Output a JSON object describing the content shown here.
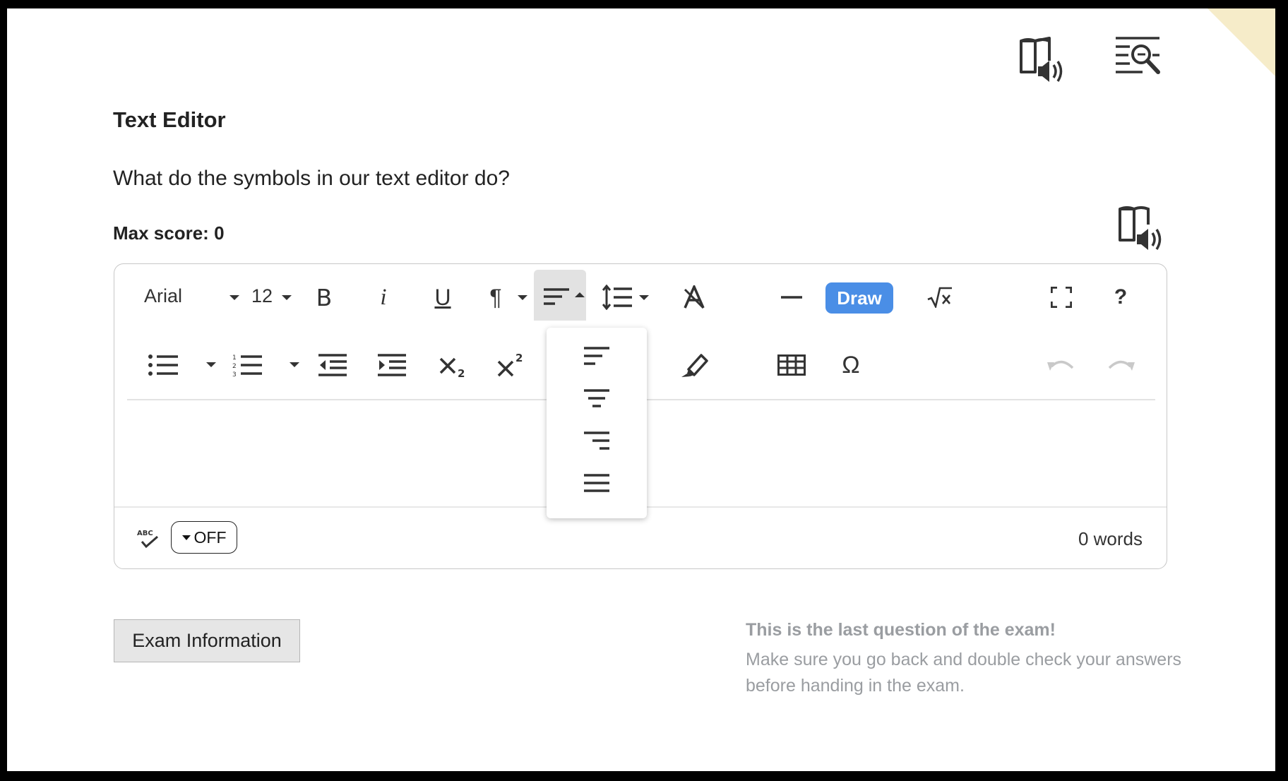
{
  "header": {
    "read_aloud_icon": "book-speaker-icon",
    "reading_tool_icon": "text-magnifier-icon"
  },
  "question": {
    "title": "Text Editor",
    "text": "What do the symbols in our text editor do?",
    "max_score": "Max score: 0"
  },
  "editor": {
    "font_family": "Arial",
    "font_size": "12",
    "toolbar_row1": [
      "bold-icon",
      "italic-icon",
      "underline-icon",
      "paragraph-icon",
      "align-left-icon",
      "line-height-icon",
      "clear-format-icon",
      "horizontal-rule-icon",
      "draw",
      "math-icon",
      "fullscreen-icon",
      "help-icon"
    ],
    "toolbar_row2": [
      "bulleted-list-icon",
      "numbered-list-icon",
      "outdent-icon",
      "indent-icon",
      "subscript-icon",
      "superscript-icon",
      "highlighter-icon",
      "table-icon",
      "special-character-icon",
      "undo-icon",
      "redo-icon"
    ],
    "bold_label": "B",
    "italic_label": "i",
    "underline_label": "U",
    "paragraph_label": "¶",
    "draw_label": "Draw",
    "help_label": "?",
    "omega_label": "Ω",
    "align_dropdown": [
      "align-left-icon",
      "align-center-icon",
      "align-right-icon",
      "align-justify-icon"
    ],
    "spellcheck_label": "OFF",
    "word_count": "0 words"
  },
  "footer": {
    "exam_info_label": "Exam Information",
    "last_question_title": "This is the last question of the exam!",
    "last_question_body": "Make sure you go back and double check your answers before handing in the exam."
  },
  "colors": {
    "draw_button": "#4a8ee6",
    "notice_text": "#9a9da1",
    "corner_accent": "#f6ecc9"
  }
}
